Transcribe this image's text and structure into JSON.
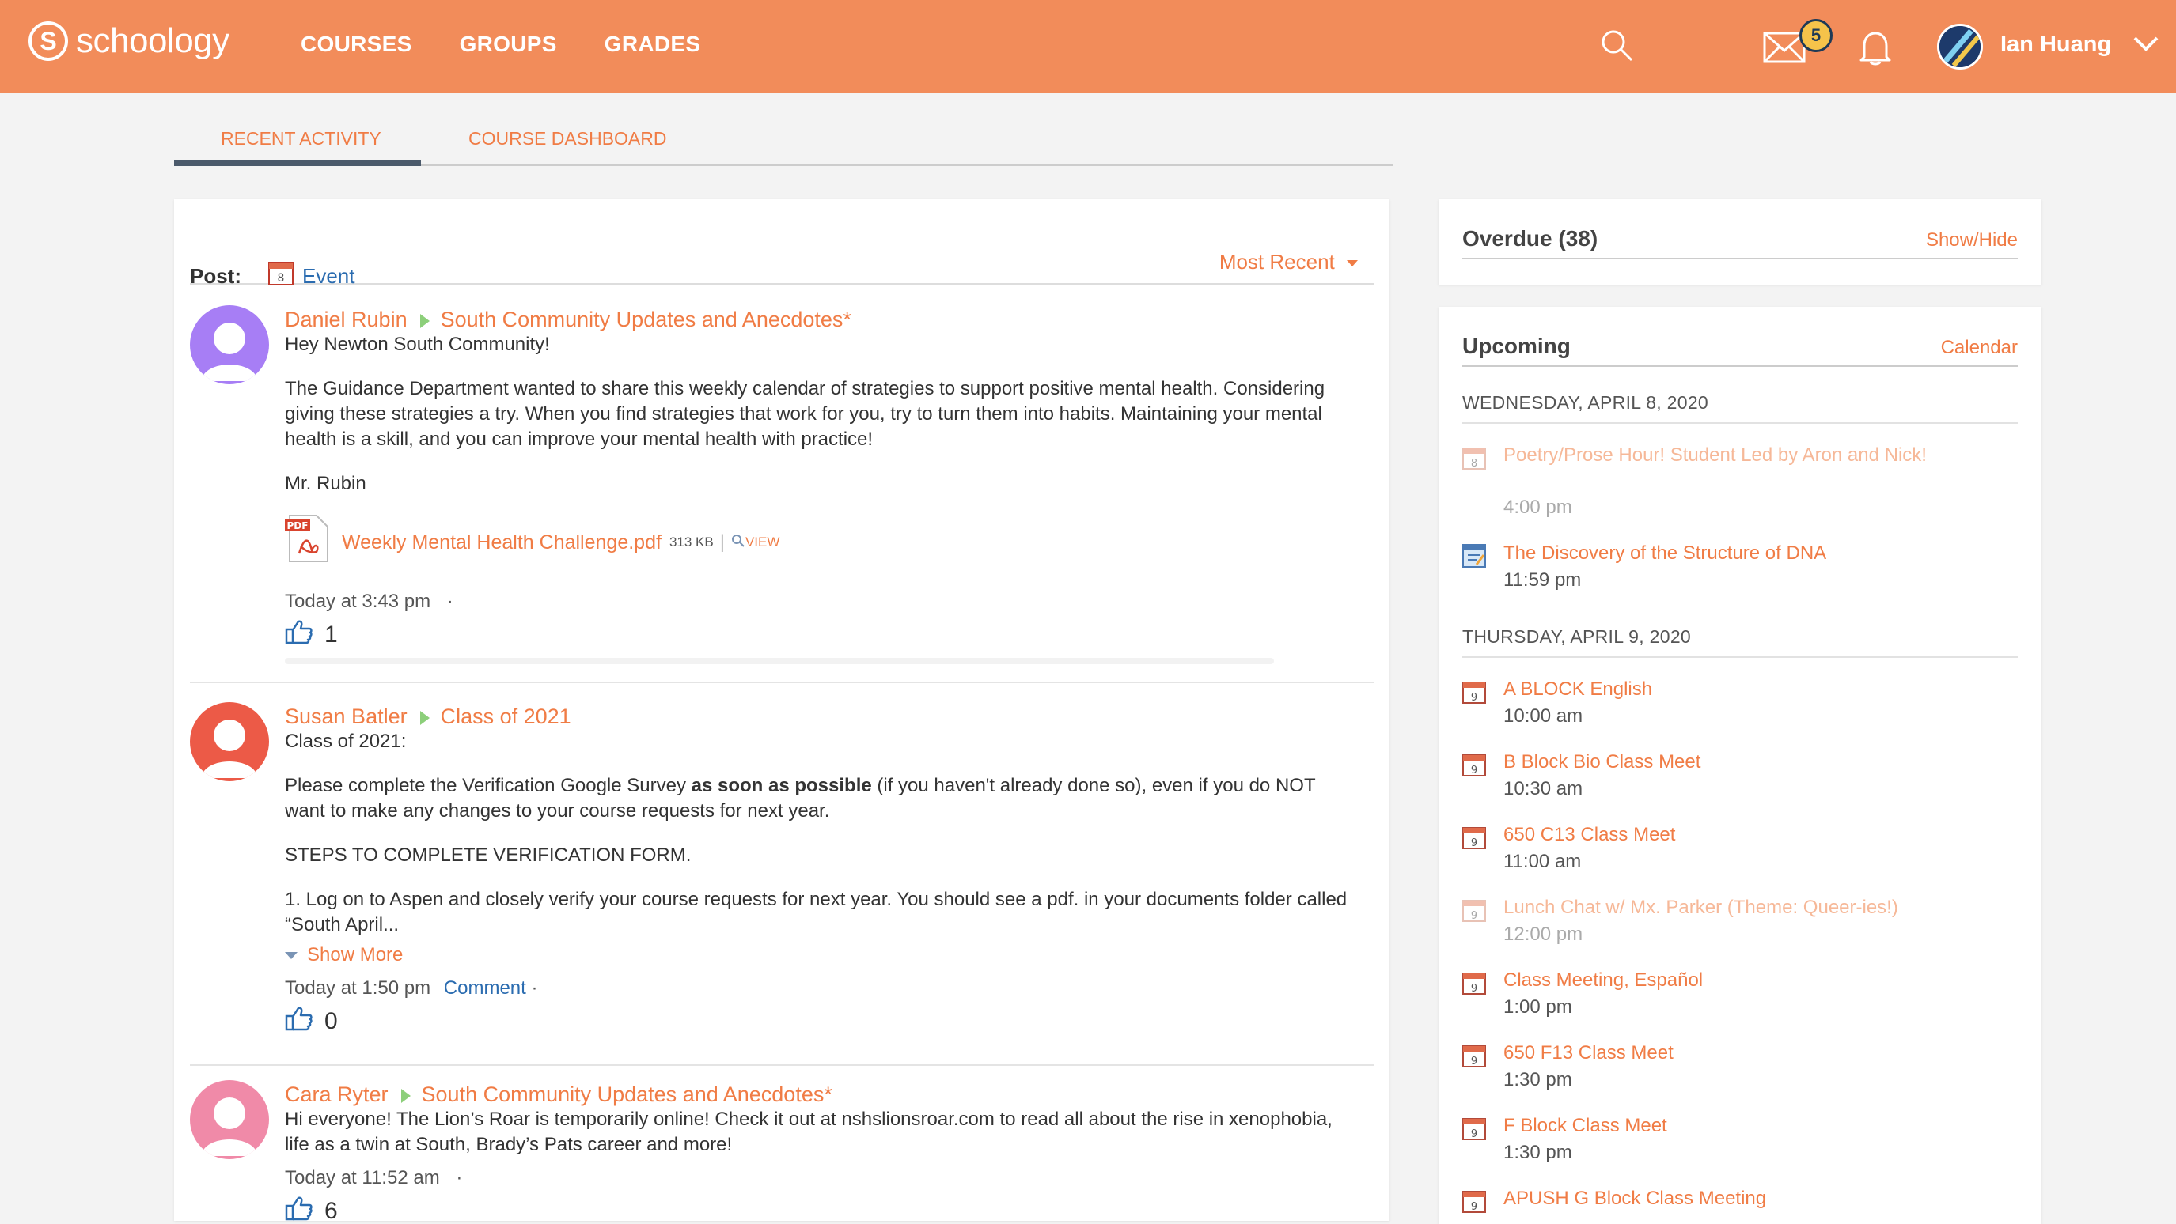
{
  "header": {
    "logo_letter": "S",
    "logo_text": "schoology",
    "nav": [
      "COURSES",
      "GROUPS",
      "GRADES"
    ],
    "mail_badge": "5",
    "user_name": "Ian Huang"
  },
  "tabs": {
    "recent": "RECENT ACTIVITY",
    "dashboard": "COURSE DASHBOARD"
  },
  "feed": {
    "post_label": "Post:",
    "event_label": "Event",
    "event_icon_day": "8",
    "sort_label": "Most Recent",
    "items": [
      {
        "author": "Daniel Rubin",
        "group": "South Community Updates and Anecdotes*",
        "greeting": "Hey Newton South Community!",
        "p1": "The Guidance Department wanted to share this weekly calendar of strategies to support positive mental health. Considering giving these strategies a try. When you find strategies that work for you, try to turn them into habits. Maintaining your mental health is a skill, and you can improve your mental health with practice!",
        "p2": "Mr. Rubin",
        "file_badge": "PDF",
        "file_name": "Weekly Mental Health Challenge.pdf",
        "file_size": "313 KB",
        "file_sep": "|",
        "view": "VIEW",
        "time": "Today at 3:43 pm",
        "dot": "·",
        "likes": "1"
      },
      {
        "author": "Susan Batler",
        "group": "Class of 2021",
        "greeting": "Class of 2021:",
        "p1_a": "Please complete the Verification Google Survey ",
        "p1_b": "as soon as possible",
        "p1_c": " (if you haven't already done so), even if you do NOT want to make any changes to your course requests for next year.",
        "p2": "STEPS TO COMPLETE VERIFICATION FORM.",
        "p3": "1. Log on to Aspen and closely verify your course requests for next year. You should see a pdf. in your documents folder called “South April...",
        "show_more": "Show More",
        "time": "Today at 1:50 pm",
        "comment": "Comment",
        "dot": "·",
        "likes": "0"
      },
      {
        "author": "Cara Ryter",
        "group": "South Community Updates and Anecdotes*",
        "text": "Hi everyone! The Lion’s Roar is temporarily online! Check it out at nshslionsroar.com to read all about the rise in xenophobia, life as a twin at South, Brady’s Pats career and more!",
        "time": "Today at 11:52 am",
        "dot": "·",
        "likes": "6"
      }
    ]
  },
  "overdue": {
    "title": "Overdue (38)",
    "link": "Show/Hide"
  },
  "upcoming": {
    "title": "Upcoming",
    "link": "Calendar",
    "day1": "WEDNESDAY, APRIL 8, 2020",
    "day1_events": [
      {
        "title": "Poetry/Prose Hour! Student Led by Aron and Nick!",
        "time": "4:00 pm",
        "day": "8"
      },
      {
        "title": "The Discovery of the Structure of DNA",
        "time": "11:59 pm"
      }
    ],
    "day2": "THURSDAY, APRIL 9, 2020",
    "day2_events": [
      {
        "title": "A BLOCK English",
        "time": "10:00 am",
        "day": "9"
      },
      {
        "title": "B Block Bio Class Meet",
        "time": "10:30 am",
        "day": "9"
      },
      {
        "title": "650 C13 Class Meet",
        "time": "11:00 am",
        "day": "9"
      },
      {
        "title": "Lunch Chat w/ Mx. Parker (Theme: Queer-ies!)",
        "time": "12:00 pm",
        "day": "9"
      },
      {
        "title": "Class Meeting, Español",
        "time": "1:00 pm",
        "day": "9"
      },
      {
        "title": "650 F13 Class Meet",
        "time": "1:30 pm",
        "day": "9"
      },
      {
        "title": "F Block Class Meet",
        "time": "1:30 pm",
        "day": "9"
      },
      {
        "title": "APUSH G Block Class Meeting",
        "time": "",
        "day": "9"
      }
    ]
  },
  "colors": {
    "header": "#f28c5a",
    "link_orange": "#f07c45",
    "link_blue": "#2b6cb0"
  }
}
